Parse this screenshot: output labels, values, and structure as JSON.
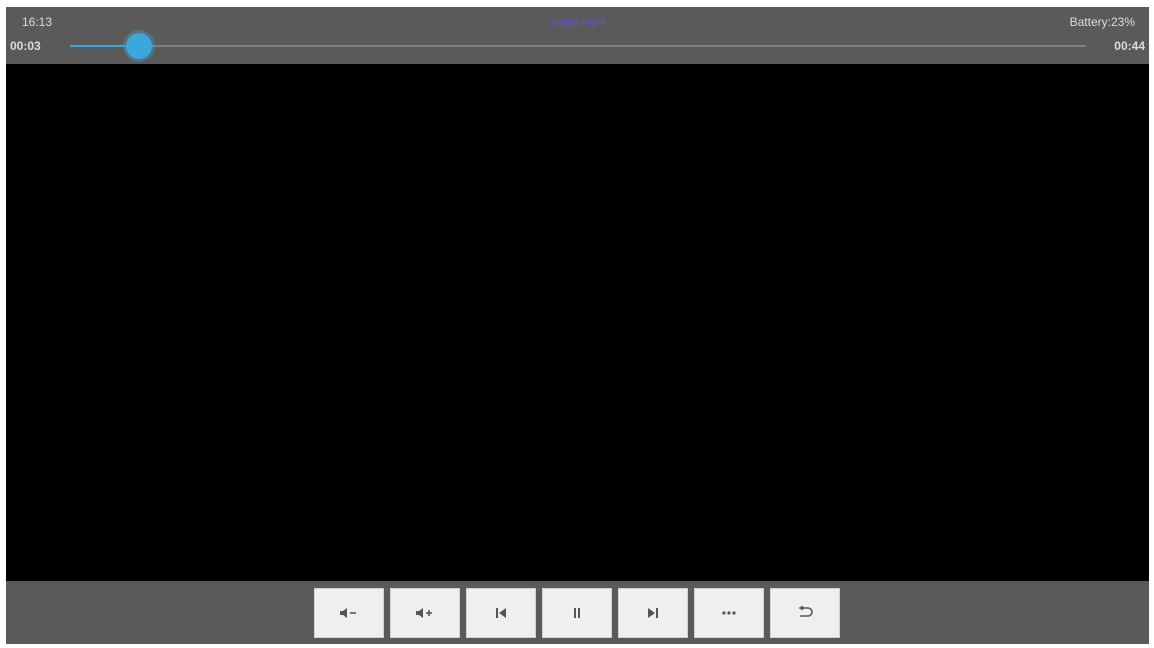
{
  "status": {
    "time": "16:13",
    "title": "video.mp4",
    "battery": "Battery:23%"
  },
  "playback": {
    "elapsed": "00:03",
    "duration": "00:44",
    "progress_fraction": 0.068
  },
  "colors": {
    "accent": "#3da6db",
    "title": "#5a52e0",
    "bar": "#5a5a5a",
    "button": "#efefef"
  },
  "controls": [
    {
      "name": "volume-down-button",
      "icon": "volume-down-icon"
    },
    {
      "name": "volume-up-button",
      "icon": "volume-up-icon"
    },
    {
      "name": "previous-button",
      "icon": "skip-previous-icon"
    },
    {
      "name": "pause-button",
      "icon": "pause-icon"
    },
    {
      "name": "next-button",
      "icon": "skip-next-icon"
    },
    {
      "name": "more-button",
      "icon": "more-icon"
    },
    {
      "name": "back-button",
      "icon": "return-icon"
    }
  ]
}
